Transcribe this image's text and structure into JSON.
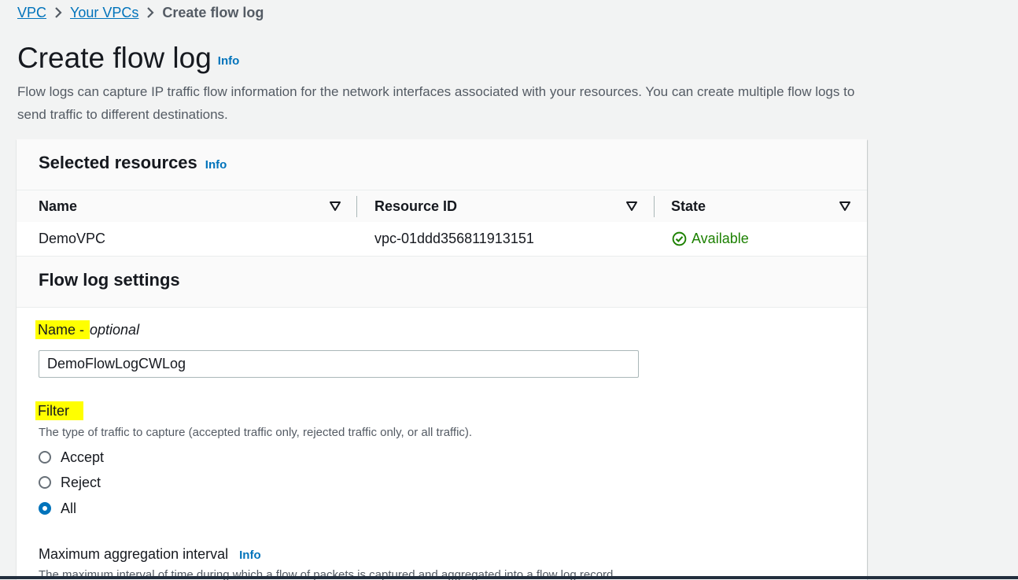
{
  "breadcrumb": {
    "items": [
      "VPC",
      "Your VPCs"
    ],
    "current": "Create flow log"
  },
  "page": {
    "title": "Create flow log",
    "info": "Info",
    "description": "Flow logs can capture IP traffic flow information for the network interfaces associated with your resources. You can create multiple flow logs to send traffic to different destinations."
  },
  "selected_resources": {
    "title": "Selected resources",
    "info": "Info",
    "columns": [
      "Name",
      "Resource ID",
      "State"
    ],
    "rows": [
      {
        "name": "DemoVPC",
        "resource_id": "vpc-01ddd356811913151",
        "state": "Available"
      }
    ]
  },
  "settings": {
    "title": "Flow log settings",
    "name_label": "Name - ",
    "name_optional": "optional",
    "name_value": "DemoFlowLogCWLog",
    "filter_label": "Filter",
    "filter_desc": "The type of traffic to capture (accepted traffic only, rejected traffic only, or all traffic).",
    "filter_options": [
      "Accept",
      "Reject",
      "All"
    ],
    "filter_selected": "All",
    "agg_label": "Maximum aggregation interval",
    "agg_info": "Info",
    "agg_desc": "The maximum interval of time during which a flow of packets is captured and aggregated into a flow log record."
  },
  "colors": {
    "link": "#0073bb",
    "success": "#1d8102",
    "highlight": "#ffff00"
  }
}
